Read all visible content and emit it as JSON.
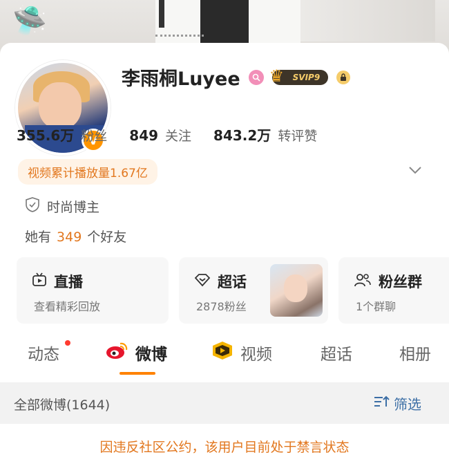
{
  "profile": {
    "name": "李雨桐Luyee",
    "verified_badge": "V",
    "vip_label": "SVIP9",
    "stats": [
      {
        "value": "355.6万",
        "label": "粉丝"
      },
      {
        "value": "849",
        "label": "关注"
      },
      {
        "value": "843.2万",
        "label": "转评赞"
      }
    ],
    "plays": "视频累计播放量1.67亿",
    "tag": "时尚博主",
    "friends_prefix": "她有",
    "friends_count": "349",
    "friends_suffix": "个好友"
  },
  "tiles": [
    {
      "title": "直播",
      "sub": "查看精彩回放",
      "icon": "tv-icon"
    },
    {
      "title": "超话",
      "sub": "2878粉丝",
      "icon": "diamond-icon"
    },
    {
      "title": "粉丝群",
      "sub": "1个群聊",
      "icon": "group-icon"
    }
  ],
  "tabs": [
    {
      "label": "动态",
      "dot": true
    },
    {
      "label": "微博",
      "active": true
    },
    {
      "label": "视频"
    },
    {
      "label": "超话"
    },
    {
      "label": "相册"
    }
  ],
  "filter": {
    "left": "全部微博(1644)",
    "right": "筛选"
  },
  "notice": "因违反社区公约，该用户目前处于禁言状态",
  "colors": {
    "accent": "#ff8200",
    "orange_text": "#e2771e",
    "link_blue": "#3b6ea5"
  }
}
